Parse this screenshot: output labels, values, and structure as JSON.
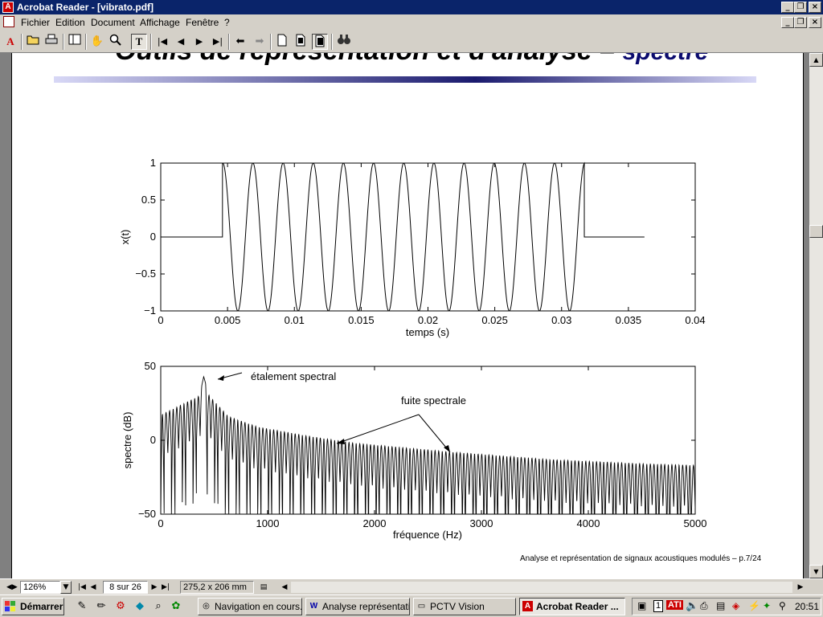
{
  "window": {
    "title": "Acrobat Reader - [vibrato.pdf]",
    "controls": {
      "minimize": "_",
      "restore": "❐",
      "close": "×"
    }
  },
  "menu": [
    "Fichier",
    "Edition",
    "Document",
    "Affichage",
    "Fenêtre",
    "?"
  ],
  "toolbar": {
    "icons": [
      "acrobat-logo-icon",
      "open-folder-icon",
      "print-icon",
      "thumbnails-icon",
      "hand-tool-icon",
      "zoom-tool-icon",
      "text-select-icon",
      "first-page-icon",
      "previous-page-icon",
      "next-page-icon",
      "last-page-icon",
      "go-back-icon",
      "go-forward-icon",
      "single-page-icon",
      "continuous-icon",
      "facing-pages-icon",
      "find-icon"
    ]
  },
  "slide": {
    "title_main": "Outils de représentation et d'analyse – ",
    "title_highlight": "spectre",
    "footer": "Analyse et représentation de signaux acoustiques modulés – p.7/24"
  },
  "annotations": {
    "peak": "étalement spectral",
    "leakage": "fuite spectrale"
  },
  "chart_data": [
    {
      "type": "line",
      "xlabel": "temps (s)",
      "ylabel": "x(t)",
      "xlim": [
        0,
        0.04
      ],
      "ylim": [
        -1,
        1
      ],
      "xticks": [
        "0",
        "0.005",
        "0.01",
        "0.015",
        "0.02",
        "0.025",
        "0.03",
        "0.035",
        "0.04"
      ],
      "yticks": [
        "−1",
        "−0.5",
        "0",
        "0.5",
        "1"
      ],
      "signal": {
        "t_start": 0.00462,
        "t_stop": 0.0317,
        "t_end": 0.0362,
        "frequency_hz": 443,
        "amplitude": 1,
        "phase_cycles": 0.24
      },
      "grid": false
    },
    {
      "type": "line",
      "xlabel": "fréquence (Hz)",
      "ylabel": "spectre (dB)",
      "xlim": [
        0,
        5512
      ],
      "ylim": [
        -50,
        50
      ],
      "xticks": [
        "0",
        "1000",
        "2000",
        "3000",
        "4000",
        "5000"
      ],
      "yticks": [
        "−50",
        "0",
        "50"
      ],
      "peak": {
        "frequency_hz": 443,
        "level_db": 43
      },
      "sidelobe_spacing_hz": 37,
      "envelope_db": [
        [
          0,
          17
        ],
        [
          400,
          30
        ],
        [
          443,
          43
        ],
        [
          500,
          30
        ],
        [
          700,
          16
        ],
        [
          1000,
          9
        ],
        [
          1500,
          3
        ],
        [
          2000,
          -2
        ],
        [
          3000,
          -8
        ],
        [
          4000,
          -13
        ],
        [
          5000,
          -16
        ],
        [
          5512,
          -17
        ]
      ],
      "grid": false
    }
  ],
  "statusbar": {
    "zoom": "126%",
    "page": "8 sur 26",
    "size": "275,2 x 206 mm"
  },
  "taskbar": {
    "start": "Démarrer",
    "tasks": [
      "Navigation en cours...",
      "Analyse représentati...",
      "PCTV Vision",
      "Acrobat Reader ..."
    ],
    "clock": "20:51"
  }
}
